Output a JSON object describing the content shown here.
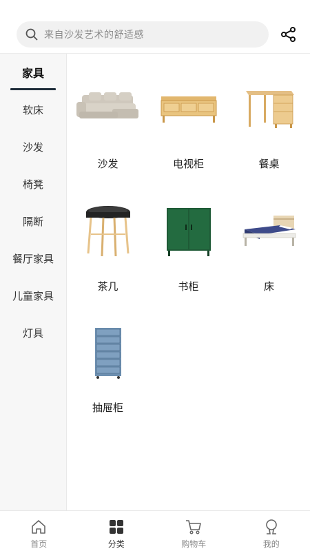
{
  "search": {
    "placeholder": "来自沙发艺术的舒适感",
    "icon": "search-icon"
  },
  "header": {
    "share_icon": "share-icon"
  },
  "sidebar": {
    "items": [
      {
        "label": "家具",
        "active": true
      },
      {
        "label": "软床"
      },
      {
        "label": "沙发"
      },
      {
        "label": "椅凳"
      },
      {
        "label": "隔断"
      },
      {
        "label": "餐厅家具"
      },
      {
        "label": "儿童家具"
      },
      {
        "label": "灯具"
      }
    ]
  },
  "products": [
    {
      "label": "沙发",
      "icon": "sofa-image"
    },
    {
      "label": "电视柜",
      "icon": "tv-cabinet-image"
    },
    {
      "label": "餐桌",
      "icon": "dining-table-image"
    },
    {
      "label": "茶几",
      "icon": "coffee-table-image"
    },
    {
      "label": "书柜",
      "icon": "bookcase-image"
    },
    {
      "label": "床",
      "icon": "bed-image"
    },
    {
      "label": "抽屉柜",
      "icon": "drawer-cabinet-image"
    }
  ],
  "tabbar": {
    "tabs": [
      {
        "label": "首页",
        "icon": "home-icon"
      },
      {
        "label": "分类",
        "icon": "category-icon",
        "active": true
      },
      {
        "label": "购物车",
        "icon": "cart-icon"
      },
      {
        "label": "我的",
        "icon": "profile-icon"
      }
    ]
  },
  "colors": {
    "accent": "#1f2d3a",
    "sidebar_bg": "#f7f7f7",
    "search_bg": "#f1f1f1"
  }
}
